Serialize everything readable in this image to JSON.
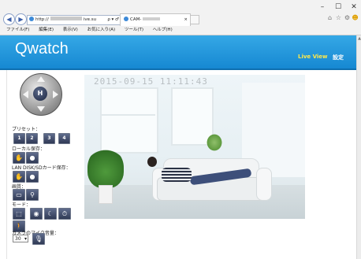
{
  "window": {
    "controls": {
      "minimize": "–",
      "maximize": "☐",
      "close": "✕"
    }
  },
  "browser": {
    "address_prefix": "http://",
    "address_suffix": "ive.su",
    "address_icons": "ρ ▾ ♂",
    "tab_title": "CAM-",
    "tab_close": "×",
    "toolbar_icons": {
      "home": "⌂",
      "favorites": "☆",
      "settings": "⚙",
      "smiley": "☻"
    },
    "menu": [
      "ファイル(F)",
      "編集(E)",
      "表示(V)",
      "お気に入り(A)",
      "ツール(T)",
      "ヘルプ(H)"
    ]
  },
  "header": {
    "logo": "Qwatch",
    "nav_live": "Live View",
    "nav_settings": "設定"
  },
  "controls": {
    "dpad_center": "H",
    "preset_label": "プリセット：",
    "presets": [
      "1",
      "2",
      "3",
      "4"
    ],
    "local_save_label": "ローカル保存：",
    "lan_save_label": "LAN DISK/SDカード保存：",
    "quality_label": "画質：",
    "mode_label": "モード：",
    "mic_label": "カメラのマイク音量：",
    "mic_value": "30"
  },
  "video": {
    "timestamp": "2015-09-15  11:11:43"
  },
  "colors": {
    "banner": "#1f95db",
    "nav_live": "#ffe84a",
    "control_button": "#3c4866"
  }
}
